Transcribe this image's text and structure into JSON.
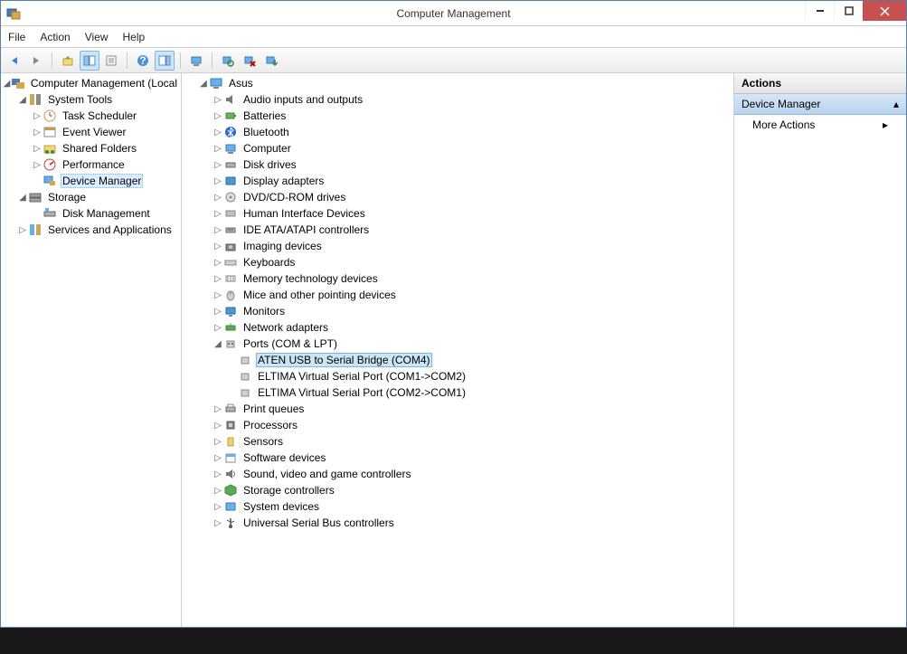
{
  "window": {
    "title": "Computer Management"
  },
  "menu": {
    "file": "File",
    "action": "Action",
    "view": "View",
    "help": "Help"
  },
  "nav": {
    "root": "Computer Management (Local",
    "system_tools": "System Tools",
    "task_scheduler": "Task Scheduler",
    "event_viewer": "Event Viewer",
    "shared_folders": "Shared Folders",
    "performance": "Performance",
    "device_manager": "Device Manager",
    "storage": "Storage",
    "disk_management": "Disk Management",
    "services": "Services and Applications"
  },
  "dev": {
    "root": "Asus",
    "audio": "Audio inputs and outputs",
    "batteries": "Batteries",
    "bluetooth": "Bluetooth",
    "computer": "Computer",
    "disk": "Disk drives",
    "display": "Display adapters",
    "dvd": "DVD/CD-ROM drives",
    "hid": "Human Interface Devices",
    "ide": "IDE ATA/ATAPI controllers",
    "imaging": "Imaging devices",
    "keyboards": "Keyboards",
    "memtech": "Memory technology devices",
    "mice": "Mice and other pointing devices",
    "monitors": "Monitors",
    "network": "Network adapters",
    "ports": "Ports (COM & LPT)",
    "port_aten": "ATEN USB to Serial Bridge (COM4)",
    "port_eltima1": "ELTIMA Virtual Serial Port (COM1->COM2)",
    "port_eltima2": "ELTIMA Virtual Serial Port (COM2->COM1)",
    "printq": "Print queues",
    "processors": "Processors",
    "sensors": "Sensors",
    "software": "Software devices",
    "sound": "Sound, video and game controllers",
    "storagectl": "Storage controllers",
    "sysdev": "System devices",
    "usb": "Universal Serial Bus controllers"
  },
  "actions": {
    "header": "Actions",
    "section": "Device Manager",
    "more": "More Actions"
  }
}
